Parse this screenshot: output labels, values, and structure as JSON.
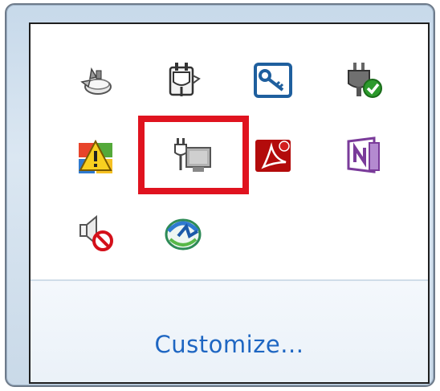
{
  "tray_overflow": {
    "customize_label": "Customize...",
    "icons": [
      {
        "name": "safely-remove-hardware-icon"
      },
      {
        "name": "power-plug-icon"
      },
      {
        "name": "security-key-icon"
      },
      {
        "name": "network-connected-icon"
      },
      {
        "name": "action-center-warning-icon"
      },
      {
        "name": "power-plugged-in-icon"
      },
      {
        "name": "adobe-reader-icon"
      },
      {
        "name": "onenote-icon"
      },
      {
        "name": "volume-muted-icon"
      },
      {
        "name": "windows-update-icon"
      }
    ],
    "highlight_color": "#e0131f",
    "link_color": "#1e66c2"
  }
}
